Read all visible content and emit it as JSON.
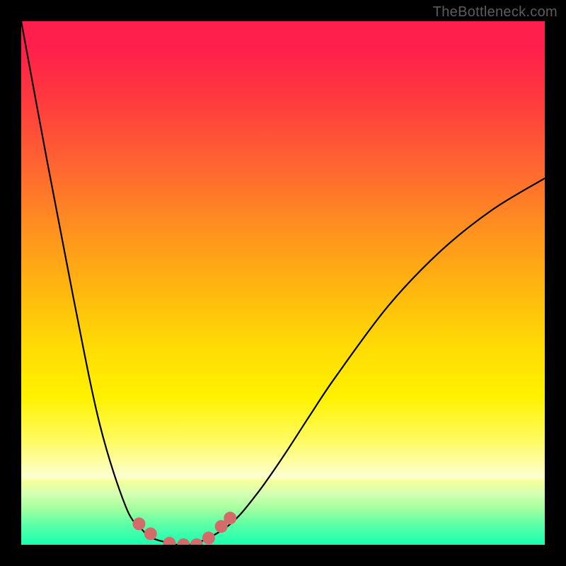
{
  "watermark": "TheBottleneck.com",
  "colors": {
    "curve": "#000000",
    "marker": "#d46a6a",
    "frame": "#000000"
  },
  "chart_data": {
    "type": "line",
    "title": "",
    "xlabel": "",
    "ylabel": "",
    "x": [
      0.0,
      0.05,
      0.1,
      0.15,
      0.2,
      0.23,
      0.25,
      0.28,
      0.3,
      0.34,
      0.4,
      0.45,
      0.5,
      0.55,
      0.6,
      0.7,
      0.8,
      0.9,
      1.0
    ],
    "values": [
      1.0,
      0.73,
      0.47,
      0.23,
      0.072,
      0.03,
      0.013,
      0.004,
      0.0,
      0.005,
      0.04,
      0.097,
      0.168,
      0.245,
      0.32,
      0.455,
      0.56,
      0.64,
      0.7
    ],
    "highlight_points": [
      {
        "x": 0.225,
        "y": 0.04
      },
      {
        "x": 0.247,
        "y": 0.021
      },
      {
        "x": 0.283,
        "y": 0.003
      },
      {
        "x": 0.31,
        "y": 0.0
      },
      {
        "x": 0.335,
        "y": 0.0
      },
      {
        "x": 0.358,
        "y": 0.013
      },
      {
        "x": 0.382,
        "y": 0.035
      },
      {
        "x": 0.399,
        "y": 0.051
      }
    ],
    "xlim": [
      0,
      1
    ],
    "ylim": [
      0,
      1
    ],
    "axes_visible": false,
    "grid": false
  }
}
